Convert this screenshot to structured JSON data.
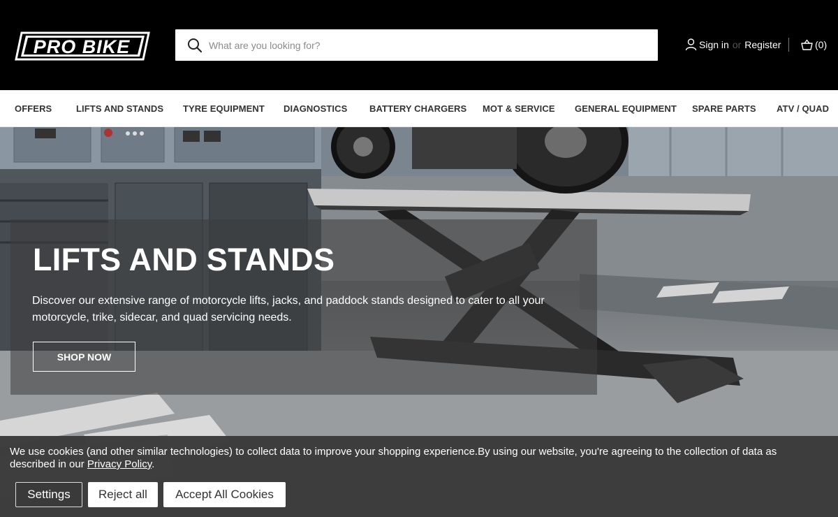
{
  "header": {
    "logo_text": "ProBike",
    "search": {
      "placeholder": "What are you looking for?",
      "value": ""
    },
    "account": {
      "sign_in": "Sign in",
      "or": "or",
      "register": "Register"
    },
    "cart": {
      "count_label": "(0)"
    }
  },
  "nav": {
    "items": [
      {
        "label": "OFFERS"
      },
      {
        "label": "LIFTS AND STANDS"
      },
      {
        "label": "TYRE EQUIPMENT"
      },
      {
        "label": "DIAGNOSTICS"
      },
      {
        "label": "BATTERY CHARGERS"
      },
      {
        "label": "MOT & SERVICE"
      },
      {
        "label": "GENERAL EQUIPMENT"
      },
      {
        "label": "SPARE PARTS"
      },
      {
        "label": "ATV / QUAD"
      }
    ]
  },
  "hero": {
    "title": "LIFTS AND STANDS",
    "text": "Discover our extensive range of motorcycle lifts, jacks, and paddock stands designed to cater to all your motorcycle, trike, sidecar, and quad servicing needs.",
    "button": "SHOP NOW"
  },
  "cookie": {
    "text_before": "We use cookies (and other similar technologies) to collect data to improve your shopping experience.By using our website, you're agreeing to the collection of data as described in our ",
    "privacy_link": "Privacy Policy",
    "text_after": ".",
    "buttons": {
      "settings": "Settings",
      "reject": "Reject all",
      "accept": "Accept All Cookies"
    }
  },
  "colors": {
    "header_bg": "#000000",
    "nav_text": "#333333",
    "cookie_bg": "#3a3a3a"
  }
}
